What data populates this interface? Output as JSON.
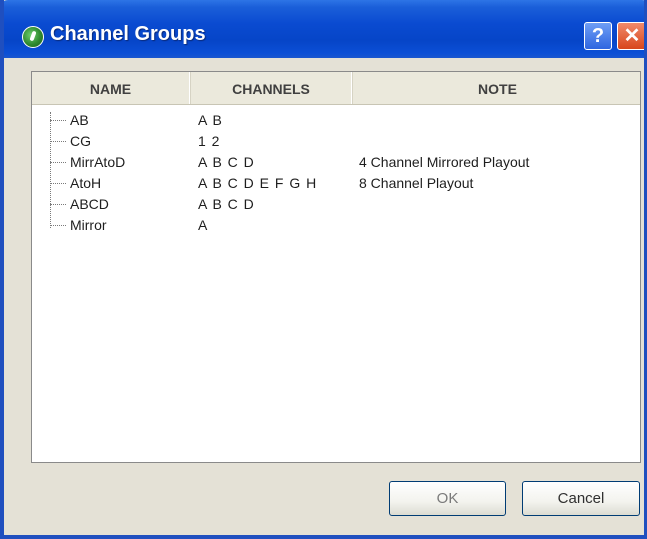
{
  "window": {
    "title": "Channel Groups",
    "help_label": "?",
    "close_label": "✕",
    "icon": "app-globe-icon"
  },
  "table": {
    "columns": [
      "NAME",
      "CHANNELS",
      "NOTE"
    ],
    "rows": [
      {
        "name": "AB",
        "channels": "A B",
        "note": ""
      },
      {
        "name": "CG",
        "channels": "1 2",
        "note": ""
      },
      {
        "name": "MirrAtoD",
        "channels": "A B C D",
        "note": "4 Channel Mirrored Playout"
      },
      {
        "name": "AtoH",
        "channels": "A B C D E F G H",
        "note": "8 Channel Playout"
      },
      {
        "name": "ABCD",
        "channels": "A B C D",
        "note": ""
      },
      {
        "name": "Mirror",
        "channels": "A",
        "note": ""
      }
    ]
  },
  "buttons": {
    "ok": "OK",
    "cancel": "Cancel"
  }
}
